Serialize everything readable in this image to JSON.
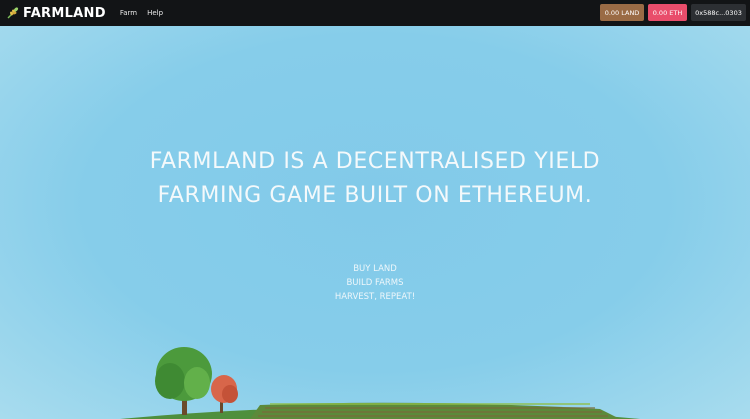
{
  "brand": {
    "name": "FARMLAND",
    "logo_icon": "wheat-icon"
  },
  "nav": {
    "links": [
      "Farm",
      "Help"
    ]
  },
  "wallet": {
    "land_balance": "0.00 LAND",
    "eth_balance": "0.00 ETH",
    "address": "0x588c...0303"
  },
  "colors": {
    "navbar": "#121416",
    "land_pill": "#9a6b45",
    "eth_pill": "#e94d6b",
    "wallet_pill": "#2c2f33",
    "sky": "#87cdea"
  },
  "hero": {
    "headline_line1": "FARMLAND IS A DECENTRALISED YIELD",
    "headline_line2": "FARMING GAME BUILT ON ETHEREUM.",
    "taglines": [
      "BUY LAND",
      "BUILD FARMS",
      "HARVEST, REPEAT!"
    ]
  }
}
